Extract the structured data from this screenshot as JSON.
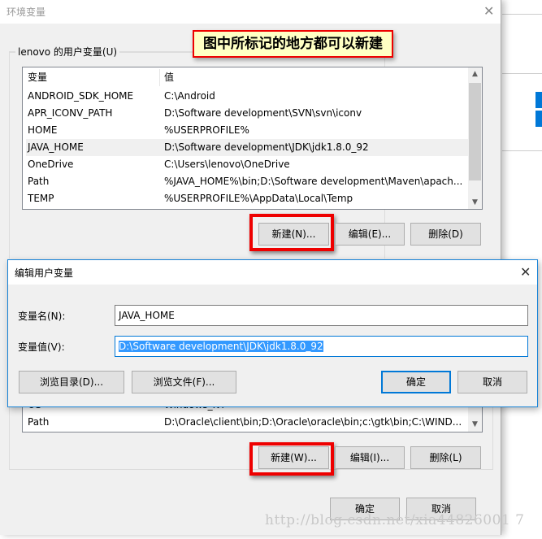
{
  "main_window": {
    "title": "环境变量",
    "user_vars_label": "lenovo 的用户变量(U)",
    "columns": [
      "变量",
      "值"
    ],
    "user_vars": [
      {
        "name": "ANDROID_SDK_HOME",
        "value": "C:\\Android"
      },
      {
        "name": "APR_ICONV_PATH",
        "value": "D:\\Software development\\SVN\\svn\\iconv"
      },
      {
        "name": "HOME",
        "value": "%USERPROFILE%"
      },
      {
        "name": "JAVA_HOME",
        "value": "D:\\Software development\\JDK\\jdk1.8.0_92"
      },
      {
        "name": "OneDrive",
        "value": "C:\\Users\\lenovo\\OneDrive"
      },
      {
        "name": "Path",
        "value": "%JAVA_HOME%\\bin;D:\\Software development\\Maven\\apach..."
      },
      {
        "name": "TEMP",
        "value": "%USERPROFILE%\\AppData\\Local\\Temp"
      }
    ],
    "selected_index": 3,
    "user_buttons": {
      "new": "新建(N)...",
      "edit": "编辑(E)...",
      "delete": "删除(D)"
    },
    "system_vars": [
      {
        "name": "OS",
        "value": "Windows_NT"
      },
      {
        "name": "Path",
        "value": "D:\\Oracle\\client\\bin;D:\\Oracle\\oracle\\bin;c:\\gtk\\bin;C:\\WIND..."
      }
    ],
    "system_buttons": {
      "new": "新建(W)...",
      "edit": "编辑(I)...",
      "delete": "删除(L)"
    },
    "ok": "确定",
    "cancel": "取消"
  },
  "annotation": {
    "text": "图中所标记的地方都可以新建",
    "border_color": "#ee0000",
    "bg_color": "#ffffc4"
  },
  "edit_dialog": {
    "title": "编辑用户变量",
    "name_label": "变量名(N):",
    "name_value": "JAVA_HOME",
    "value_label": "变量值(V):",
    "value_value": "D:\\Software development\\JDK\\jdk1.8.0_92",
    "browse_dir": "浏览目录(D)...",
    "browse_file": "浏览文件(F)...",
    "ok": "确定",
    "cancel": "取消"
  },
  "watermark": "http://blog.csdn.net/xia44826001 7",
  "colors": {
    "accent": "#0078d7",
    "selection": "#3399ff"
  }
}
